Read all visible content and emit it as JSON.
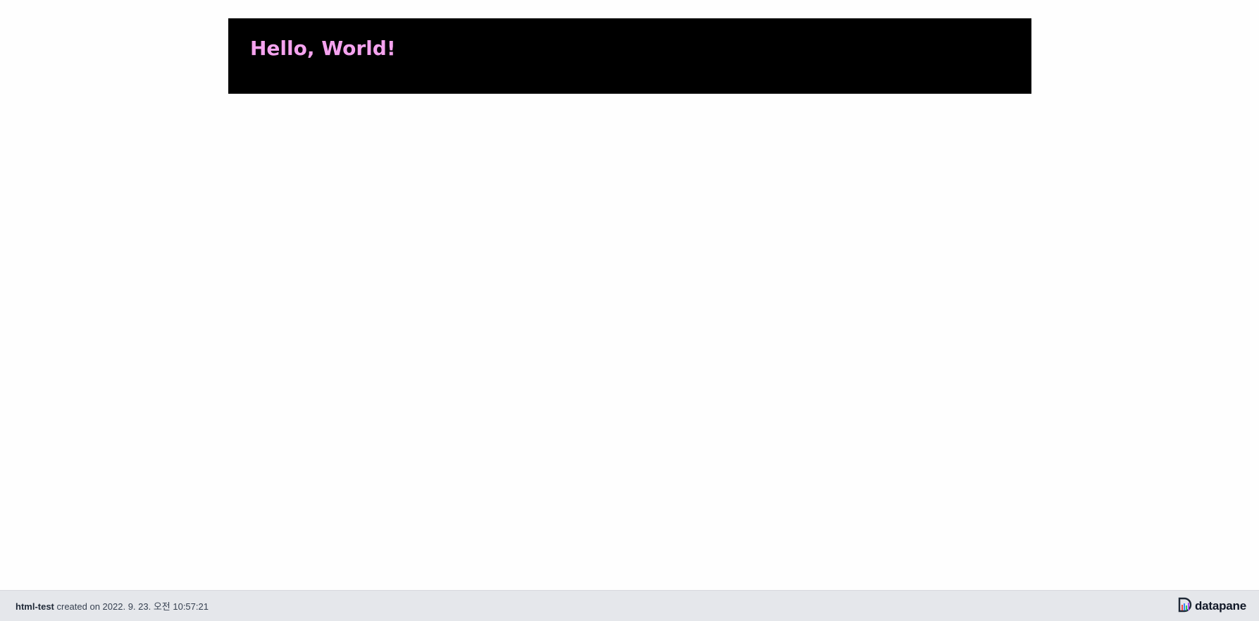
{
  "content": {
    "heading": "Hello, World!",
    "heading_color": "#f5a3ef",
    "block_background": "#000000"
  },
  "footer": {
    "report_name": "html-test",
    "created_text": " created on 2022. 9. 23. 오전 10:57:21",
    "brand_name": "datapane",
    "brand_icon": "datapane-logo-icon"
  }
}
